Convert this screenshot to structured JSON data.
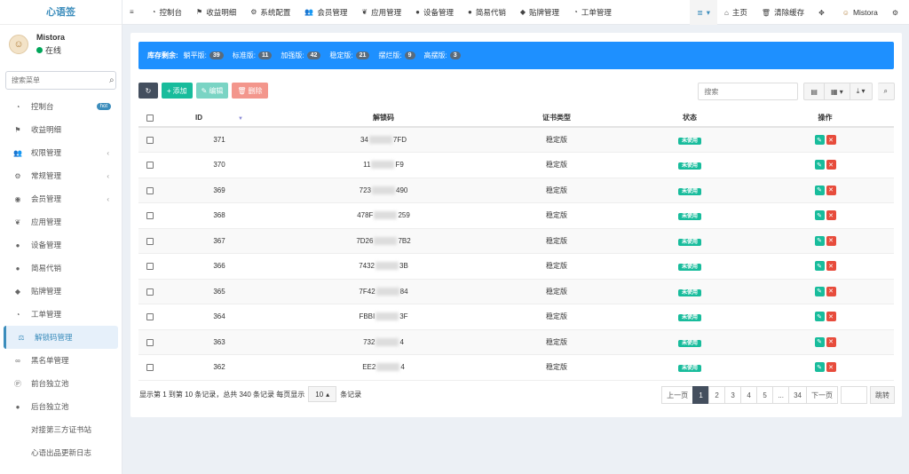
{
  "brand": "心语签",
  "user": {
    "name": "Mistora",
    "status": "在线"
  },
  "sidebar": {
    "search_placeholder": "搜索菜单",
    "items": [
      {
        "label": "控制台",
        "icon": "dashboard-icon",
        "badge": "hot"
      },
      {
        "label": "收益明细",
        "icon": "flag-icon"
      },
      {
        "label": "权限管理",
        "icon": "group-icon",
        "arrow": true
      },
      {
        "label": "常规管理",
        "icon": "cogs-icon",
        "arrow": true
      },
      {
        "label": "会员管理",
        "icon": "user-circle-icon",
        "arrow": true
      },
      {
        "label": "应用管理",
        "icon": "leaf-icon"
      },
      {
        "label": "设备管理",
        "icon": "circle-icon"
      },
      {
        "label": "简易代销",
        "icon": "circle-icon"
      },
      {
        "label": "贴牌管理",
        "icon": "tags-icon"
      },
      {
        "label": "工单管理",
        "icon": "dashboard-icon"
      },
      {
        "label": "解锁码管理",
        "icon": "balance-icon",
        "active": true
      },
      {
        "label": "黑名单管理",
        "icon": "bicycle-icon"
      },
      {
        "label": "前台独立池",
        "icon": "product-hunt-icon"
      },
      {
        "label": "后台独立池",
        "icon": "apple-icon"
      },
      {
        "label": "对接第三方证书站",
        "icon": "code-icon"
      },
      {
        "label": "心语出品更新日志",
        "icon": "code-icon"
      }
    ]
  },
  "topnav": {
    "items": [
      {
        "label": "",
        "icon": "menu-icon"
      },
      {
        "label": "控制台",
        "icon": "dashboard-icon"
      },
      {
        "label": "收益明细",
        "icon": "flag-icon"
      },
      {
        "label": "系统配置",
        "icon": "gear-icon"
      },
      {
        "label": "会员管理",
        "icon": "users-icon"
      },
      {
        "label": "应用管理",
        "icon": "leaf-icon"
      },
      {
        "label": "设备管理",
        "icon": "circle-icon"
      },
      {
        "label": "简易代销",
        "icon": "circle-icon"
      },
      {
        "label": "贴牌管理",
        "icon": "tag-icon"
      },
      {
        "label": "工单管理",
        "icon": "dashboard-icon"
      }
    ],
    "right": {
      "home": "主页",
      "clear_cache": "清除缓存",
      "user": "Mistora"
    }
  },
  "stock": {
    "label": "库存剩余:",
    "items": [
      {
        "name": "躺平版:",
        "count": "39"
      },
      {
        "name": "标准版:",
        "count": "11"
      },
      {
        "name": "加强版:",
        "count": "42"
      },
      {
        "name": "稳定版:",
        "count": "21"
      },
      {
        "name": "摆烂版:",
        "count": "9"
      },
      {
        "name": "高摆版:",
        "count": "3"
      }
    ]
  },
  "toolbar": {
    "add": "添加",
    "edit": "编辑",
    "delete": "删除",
    "search_placeholder": "搜索"
  },
  "table": {
    "headers": {
      "id": "ID",
      "code": "解锁码",
      "type": "证书类型",
      "status": "状态",
      "ops": "操作"
    },
    "rows": [
      {
        "id": "371",
        "code_pre": "34",
        "code_post": "7FD",
        "type": "稳定版",
        "status": "未使用"
      },
      {
        "id": "370",
        "code_pre": "11",
        "code_post": "F9",
        "type": "稳定版",
        "status": "未使用"
      },
      {
        "id": "369",
        "code_pre": "723",
        "code_post": "490",
        "type": "稳定版",
        "status": "未使用"
      },
      {
        "id": "368",
        "code_pre": "478F",
        "code_post": "259",
        "type": "稳定版",
        "status": "未使用"
      },
      {
        "id": "367",
        "code_pre": "7D26",
        "code_post": "7B2",
        "type": "稳定版",
        "status": "未使用"
      },
      {
        "id": "366",
        "code_pre": "7432",
        "code_post": "3B",
        "type": "稳定版",
        "status": "未使用"
      },
      {
        "id": "365",
        "code_pre": "7F42",
        "code_post": "84",
        "type": "稳定版",
        "status": "未使用"
      },
      {
        "id": "364",
        "code_pre": "FBBI",
        "code_post": "3F",
        "type": "稳定版",
        "status": "未使用"
      },
      {
        "id": "363",
        "code_pre": "732",
        "code_post": "4",
        "type": "稳定版",
        "status": "未使用"
      },
      {
        "id": "362",
        "code_pre": "EE2",
        "code_post": "4",
        "type": "稳定版",
        "status": "未使用"
      }
    ]
  },
  "footer": {
    "info": "显示第 1 到第 10 条记录，总共 340 条记录 每页显示",
    "page_size": "10",
    "info_suffix": "条记录",
    "pager": [
      "上一页",
      "1",
      "2",
      "3",
      "4",
      "5",
      "...",
      "34",
      "下一页"
    ],
    "jump": "跳转"
  }
}
